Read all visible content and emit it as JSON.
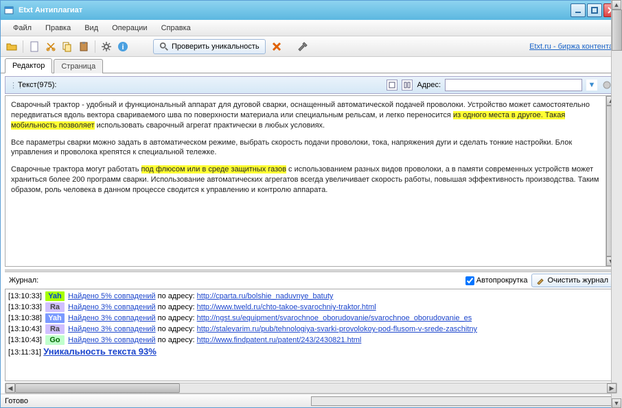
{
  "title": "Etxt Антиплагиат",
  "menu": [
    "Файл",
    "Правка",
    "Вид",
    "Операции",
    "Справка"
  ],
  "toolbar": {
    "check_label": "Проверить уникальность",
    "link_right": "Etxt.ru - биржа контента"
  },
  "tabs": {
    "editor": "Редактор",
    "page": "Страница"
  },
  "editor_bar": {
    "text_count": "Текст(975):",
    "addr_label": "Адрес:",
    "addr_value": ""
  },
  "content": {
    "p1_pre": "Сварочный трактор - удобный и функциональный аппарат для дуговой сварки, оснащенный автоматической подачей проволоки. Устройство может самостоятельно передвигаться вдоль вектора свариваемого шва по поверхности материала или специальным рельсам, и легко переносится ",
    "p1_hl": "из одного места в другое. Такая мобильность позволяет",
    "p1_post": " использовать сварочный агрегат практически в любых условиях.",
    "p2": "Все параметры сварки можно задать в автоматическом режиме, выбрать скорость подачи проволоки, тока, напряжения дуги и сделать тонкие настройки. Блок управления и проволока крепятся к специальной тележке.",
    "p3_pre": "Сварочные трактора могут работать ",
    "p3_hl": "под флюсом или в среде защитных газов",
    "p3_post": " с использованием разных видов проволоки, а в памяти современных устройств может храниться более 200 программ сварки. Использование автоматических агрегатов всегда увеличивает скорость работы, повышая эффективность производства. Таким образом, роль человека в данном процессе сводится к управлению и контролю аппарата."
  },
  "log_header": {
    "title": "Журнал:",
    "autoscroll": "Автопрокрутка",
    "clear": "Очистить журнал"
  },
  "log": [
    {
      "ts": "[13:10:33]",
      "eng": "Yah",
      "cls": "yah",
      "found": "Найдено 5% совпадений",
      "mid": " по адресу: ",
      "url": "http://cparta.ru/bolshie_naduvnye_batuty"
    },
    {
      "ts": "[13:10:33]",
      "eng": "Ra",
      "cls": "ra",
      "found": "Найдено 3% совпадений",
      "mid": " по адресу: ",
      "url": "http://www.tweld.ru/chto-takoe-svarochniy-traktor.html"
    },
    {
      "ts": "[13:10:38]",
      "eng": "Yah",
      "cls": "yah2",
      "found": "Найдено 3% совпадений",
      "mid": " по адресу: ",
      "url": "http://ngst.su/equipment/svarochnoe_oborudovanie/svarochnoe_oborudovanie_es"
    },
    {
      "ts": "[13:10:43]",
      "eng": "Ra",
      "cls": "ra",
      "found": "Найдено 3% совпадений",
      "mid": " по адресу: ",
      "url": "http://stalevarim.ru/pub/tehnologiya-svarki-provolokoy-pod-flusom-v-srede-zaschitny"
    },
    {
      "ts": "[13:10:43]",
      "eng": "Go",
      "cls": "go",
      "found": "Найдено 3% совпадений",
      "mid": " по адресу: ",
      "url": "http://www.findpatent.ru/patent/243/2430821.html"
    }
  ],
  "result": {
    "ts": "[13:11:31]",
    "text": "Уникальность текста 93%"
  },
  "status": "Готово"
}
